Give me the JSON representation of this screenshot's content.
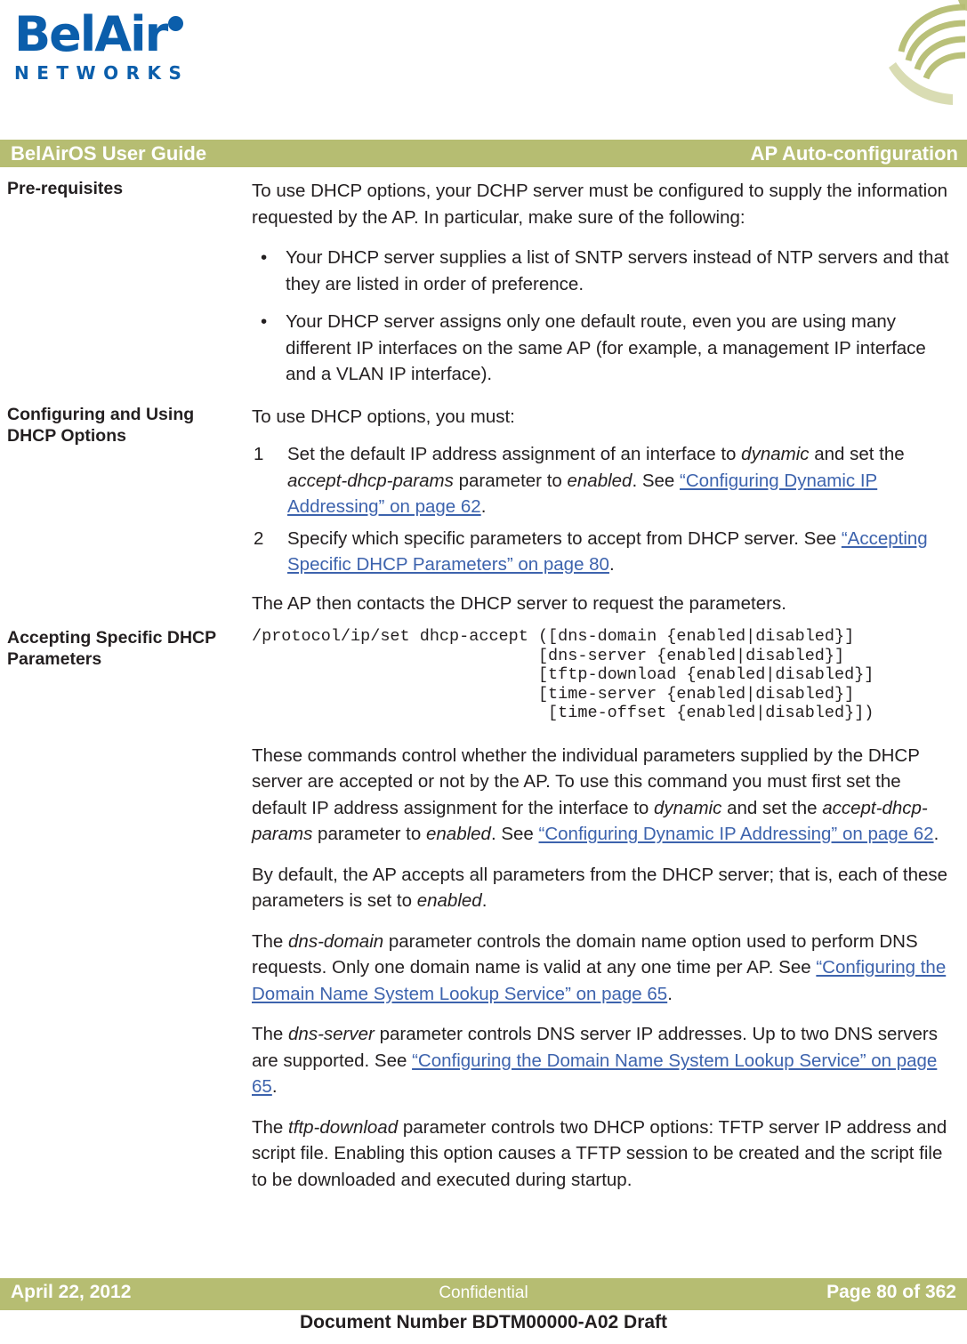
{
  "logo": {
    "brand_top": "BelAir",
    "brand_bottom": "NETWORKS",
    "color": "#0b5eab"
  },
  "header": {
    "left_title": "BelAirOS User Guide",
    "right_title": "AP Auto-configuration",
    "bar_color": "#b6bd72"
  },
  "sections": [
    {
      "heading": "Pre-requisites",
      "intro": "To use DHCP options, your DCHP server must be configured to supply the information requested by the AP. In particular, make sure of the following:",
      "bullets": [
        "Your DHCP server supplies a list of SNTP servers instead of NTP servers and that they are listed in order of preference.",
        "Your DHCP server assigns only one default route, even you are using many different IP interfaces on the same AP (for example, a management IP interface and a VLAN IP interface)."
      ]
    },
    {
      "heading": "Configuring and Using DHCP Options",
      "intro": "To use DHCP options, you must:",
      "steps": [
        {
          "num": "1",
          "p1": "Set the default IP address assignment of an interface to ",
          "i1": "dynamic",
          "p2": " and set the ",
          "i2": "accept-dhcp-params",
          "p3": " parameter to ",
          "i3": "enabled",
          "p4": ". See ",
          "link": "“Configuring Dynamic IP Addressing” on page 62",
          "p5": "."
        },
        {
          "num": "2",
          "p1": "Specify which specific parameters to accept from DHCP server. See ",
          "link": "“Accepting Specific DHCP Parameters” on page 80",
          "p5": "."
        }
      ],
      "outro": "The AP then contacts the DHCP server to request the parameters."
    },
    {
      "heading": "Accepting Specific DHCP Parameters",
      "code": "/protocol/ip/set dhcp-accept ([dns-domain {enabled|disabled}]\n                             [dns-server {enabled|disabled}]\n                             [tftp-download {enabled|disabled}]\n                             [time-server {enabled|disabled}]\n                              [time-offset {enabled|disabled}])",
      "paras": [
        {
          "t1": "These commands control whether the individual parameters supplied by the DHCP server are accepted or not by the AP. To use this command you must first set the default IP address assignment for the interface to ",
          "i1": "dynamic",
          "t2": " and set the ",
          "i2": "accept-dhcp-params",
          "t3": " parameter to ",
          "i3": "enabled",
          "t4": ". See ",
          "link": "“Configuring Dynamic IP Addressing” on page 62",
          "t5": "."
        },
        {
          "t1": "By default, the AP accepts all parameters from the DHCP server; that is, each of these parameters is set to ",
          "i1": "enabled",
          "t2": ".",
          "i2": "",
          "t3": "",
          "i3": "",
          "t4": "",
          "link": "",
          "t5": ""
        },
        {
          "t1": "The ",
          "i1": "dns-domain",
          "t2": " parameter controls the domain name option used to perform DNS requests. Only one domain name is valid at any one time per AP. See ",
          "i2": "",
          "t3": "",
          "i3": "",
          "t4": "",
          "link": "“Configuring the Domain Name System Lookup Service” on page 65",
          "t5": "."
        },
        {
          "t1": "The ",
          "i1": "dns-server",
          "t2": " parameter controls DNS server IP addresses. Up to two DNS servers are supported. See ",
          "i2": "",
          "t3": "",
          "i3": "",
          "t4": "",
          "link": "“Configuring the Domain Name System Lookup Service” on page 65",
          "t5": "."
        },
        {
          "t1": "The ",
          "i1": "tftp-download",
          "t2": " parameter controls two DHCP options: TFTP server IP address and script file. Enabling this option causes a TFTP session to be created and the script file to be downloaded and executed during startup.",
          "i2": "",
          "t3": "",
          "i3": "",
          "t4": "",
          "link": "",
          "t5": ""
        }
      ]
    }
  ],
  "footer": {
    "date": "April 22, 2012",
    "confidential": "Confidential",
    "page": "Page 80 of 362",
    "document_number": "Document Number BDTM00000-A02 Draft"
  }
}
